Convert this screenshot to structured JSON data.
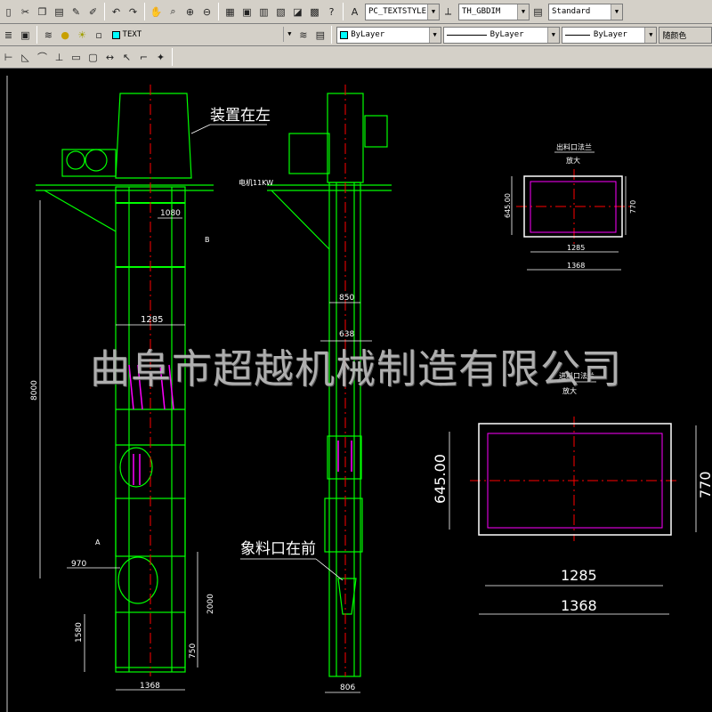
{
  "toolbar1": {
    "text_style": "PC_TEXTSTYLE",
    "dim_style": "TH_GBDIM",
    "table_style": "Standard"
  },
  "toolbar2": {
    "layer": "TEXT",
    "color": "ByLayer",
    "linetype": "ByLayer",
    "lineweight": "ByLayer",
    "plot_style": "随颜色"
  },
  "drawing": {
    "labels": {
      "device_left": "装置在左",
      "feed_front": "象料口在前",
      "motor": "电机11KW",
      "detail_top_title": "出料口法兰",
      "detail_top_sub": "放大",
      "detail_bottom_title": "进料口法兰",
      "detail_bottom_sub": "放大"
    },
    "dims": {
      "d1080": "1080",
      "d8000": "8000",
      "d1285_left": "1285",
      "d970": "970",
      "d2000": "2000",
      "d1580": "1580",
      "d750": "750",
      "d1368_left": "1368",
      "d850": "850",
      "d638": "638",
      "d806": "806",
      "t645": "645.00",
      "t770": "770",
      "t1285": "1285",
      "t1368": "1368",
      "b645": "645.00",
      "b770": "770",
      "b1285": "1285",
      "b1368": "1368",
      "mark_a": "A",
      "mark_b": "B"
    },
    "colors": {
      "frame": "#00ff00",
      "center": "#ff0000",
      "dim": "#ffffff",
      "hatch": "#ff00ff",
      "text": "#00ffff"
    }
  },
  "watermark": "曲阜市超越机械制造有限公司"
}
